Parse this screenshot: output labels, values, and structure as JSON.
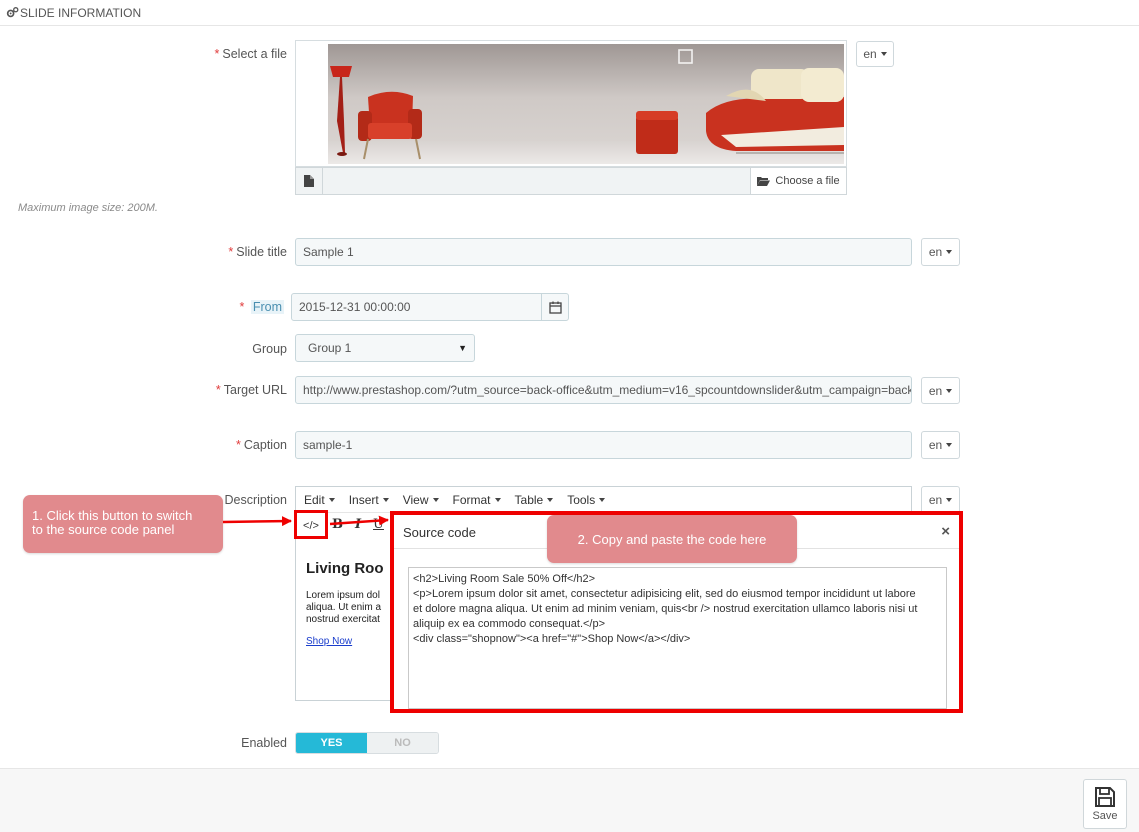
{
  "header": {
    "title": "SLIDE INFORMATION",
    "icon": "gears-icon"
  },
  "fields": {
    "file": {
      "label": "Select a file",
      "lang": "en",
      "choose_label": "Choose a file",
      "hint": "Maximum image size: 200M."
    },
    "slide_title": {
      "label": "Slide title",
      "value": "Sample 1",
      "lang": "en"
    },
    "from": {
      "label": "From",
      "value": "2015-12-31 00:00:00"
    },
    "group": {
      "label": "Group",
      "value": "Group 1"
    },
    "target_url": {
      "label": "Target URL",
      "value": "http://www.prestashop.com/?utm_source=back-office&utm_medium=v16_spcountdownslider&utm_campaign=back-off",
      "lang": "en"
    },
    "caption": {
      "label": "Caption",
      "value": "sample-1",
      "lang": "en"
    },
    "description": {
      "label": "Description",
      "lang": "en",
      "menu": [
        "Edit",
        "Insert",
        "View",
        "Format",
        "Table",
        "Tools"
      ],
      "preview_heading": "Living Roo",
      "preview_lines": [
        "Lorem ipsum dol",
        "aliqua. Ut enim a",
        "nostrud exercitat"
      ],
      "preview_link": "Shop Now"
    },
    "enabled": {
      "label": "Enabled",
      "yes": "YES",
      "no": "NO"
    }
  },
  "toolbar": {
    "bold": "B",
    "italic": "I",
    "underline": "U"
  },
  "dialog": {
    "title": "Source code",
    "close": "×",
    "code": [
      "<h2>Living Room Sale 50% Off</h2>",
      "<p>Lorem ipsum dolor sit amet, consectetur adipisicing elit, sed do eiusmod tempor incididunt ut labore",
      "et dolore magna aliqua. Ut enim ad minim veniam, quis<br /> nostrud exercitation ullamco laboris nisi ut",
      "aliquip ex ea commodo consequat.</p>",
      "<div class=\"shopnow\"><a href=\"#\">Shop Now</a></div>"
    ]
  },
  "callouts": {
    "step1": [
      "1. Click this button to switch",
      "to the source code panel"
    ],
    "step2": "2. Copy and paste the code here"
  },
  "footer": {
    "save_label": "Save"
  },
  "colors": {
    "accent": "#25b9d7",
    "required": "#e03a3a",
    "callout": "#e18a8d",
    "highlight": "#ee0000"
  }
}
